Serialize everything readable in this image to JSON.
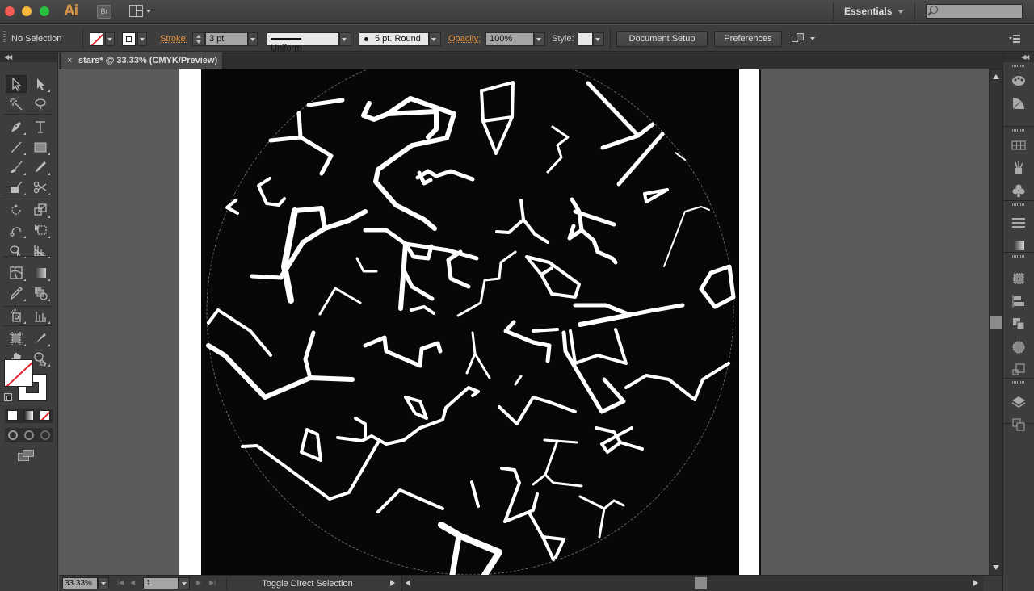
{
  "app": {
    "logo": "Ai",
    "bridge_label": "Br",
    "workspace": "Essentials",
    "search_placeholder": ""
  },
  "control_bar": {
    "selection_status": "No Selection",
    "stroke_label": "Stroke:",
    "stroke_weight": "3 pt",
    "stroke_profile": "Uniform",
    "brush": "5 pt. Round",
    "opacity_label": "Opacity:",
    "opacity_value": "100%",
    "style_label": "Style:",
    "document_setup": "Document Setup",
    "preferences": "Preferences",
    "fill": "none",
    "stroke": "white"
  },
  "document": {
    "tab_title": "stars* @ 33.33% (CMYK/Preview)",
    "close_glyph": "×",
    "zoom": "33.33%",
    "page": "1",
    "status_text": "Toggle Direct Selection"
  },
  "tools": [
    {
      "name": "selection-tool",
      "active": true
    },
    {
      "name": "direct-selection-tool"
    },
    {
      "name": "magic-wand-tool"
    },
    {
      "name": "lasso-tool"
    },
    {
      "name": "pen-tool"
    },
    {
      "name": "type-tool"
    },
    {
      "name": "line-segment-tool"
    },
    {
      "name": "rectangle-tool"
    },
    {
      "name": "paintbrush-tool"
    },
    {
      "name": "pencil-tool"
    },
    {
      "name": "blob-brush-tool"
    },
    {
      "name": "scissors-tool"
    },
    {
      "name": "rotate-tool"
    },
    {
      "name": "scale-tool"
    },
    {
      "name": "puppet-warp-tool"
    },
    {
      "name": "free-transform-tool"
    },
    {
      "name": "shape-builder-tool"
    },
    {
      "name": "perspective-grid-tool"
    },
    {
      "name": "mesh-tool"
    },
    {
      "name": "gradient-tool"
    },
    {
      "name": "eyedropper-tool"
    },
    {
      "name": "blend-tool"
    },
    {
      "name": "symbol-sprayer-tool"
    },
    {
      "name": "column-graph-tool"
    },
    {
      "name": "artboard-tool"
    },
    {
      "name": "slice-tool"
    },
    {
      "name": "hand-tool"
    },
    {
      "name": "zoom-tool"
    }
  ],
  "dock_panels": [
    "color-panel",
    "color-guide-panel",
    "swatches-panel",
    "brushes-panel",
    "symbols-panel",
    "stroke-panel",
    "gradient-panel",
    "transform-panel",
    "align-panel",
    "pathfinder-panel",
    "appearance-panel",
    "artboards-panel",
    "layers-panel",
    "links-panel"
  ],
  "colors": {
    "accent_orange": "#e3903f",
    "canvas_black": "#050708",
    "none_red": "#e0242c"
  }
}
